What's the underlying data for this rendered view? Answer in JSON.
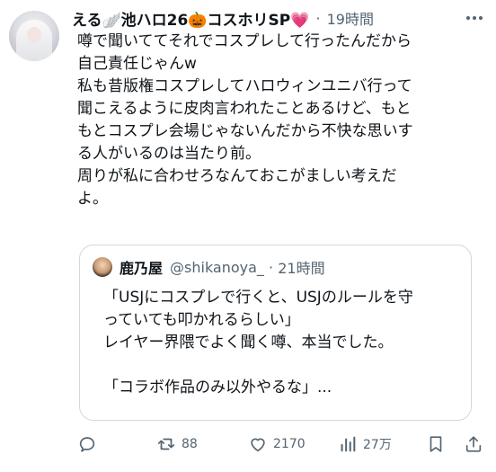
{
  "tweet": {
    "author": {
      "display_name": "える🪽池ハロ26🎃コスホリSP💗",
      "time": "19時間"
    },
    "text_lines": [
      "噂で聞いててそれでコスプレして行ったんだから",
      "自己責任じゃんw",
      "私も昔版権コスプレしてハロウィンユニバ行って",
      "聞こえるように皮肉言われたことあるけど、もと",
      "もとコスプレ会場じゃないんだから不快な思いす",
      "る人がいるのは当たり前。",
      "周りが私に合わせろなんておこがましい考えだ",
      "よ。"
    ],
    "quote": {
      "name": "鹿乃屋",
      "handle": "@shikanoya_",
      "time": "21時間",
      "text_lines": [
        "「USJにコスプレで行くと、USJのルールを守",
        "っていても叩かれるらしい」",
        "レイヤー界隈でよく聞く噂、本当でした。",
        "",
        "「コラボ作品のみ以外やるな」..."
      ]
    },
    "actions": {
      "reply_count": "",
      "retweet_count": "88",
      "like_count": "2170",
      "views_count": "27万"
    }
  },
  "icons": {
    "more": "more-icon",
    "reply": "reply-icon",
    "retweet": "retweet-icon",
    "like": "heart-icon",
    "views": "views-icon",
    "bookmark": "bookmark-icon",
    "share": "share-icon"
  },
  "colors": {
    "text": "#0f1419",
    "muted": "#536471",
    "border": "#cfd9de"
  }
}
